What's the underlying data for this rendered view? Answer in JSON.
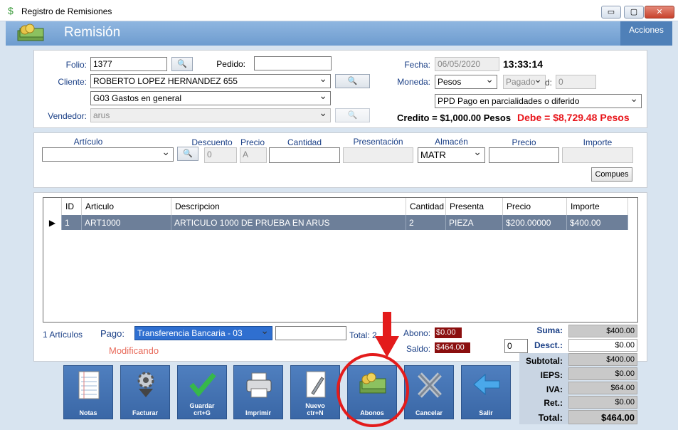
{
  "window": {
    "title": "Registro de Remisiones",
    "min": "▭",
    "max": "▢",
    "close": "✕"
  },
  "header": {
    "title": "Remisión",
    "acciones": "Acciones"
  },
  "form": {
    "folio_label": "Folio:",
    "folio": "1377",
    "pedido_label": "Pedido:",
    "pedido": "",
    "cliente_label": "Cliente:",
    "cliente": "ROBERTO LOPEZ HERNANDEZ 655",
    "uso": "G03 Gastos en general",
    "vendedor_label": "Vendedor:",
    "vendedor": "arus",
    "fecha_label": "Fecha:",
    "fecha": "06/05/2020",
    "hora": "13:33:14",
    "moneda_label": "Moneda:",
    "moneda": "Pesos",
    "pagado": "Pagado",
    "pagado_suffix": "d:",
    "dias": "0",
    "metodo": "PPD Pago en parcialidades o diferido",
    "credito": "Credito = $1,000.00 Pesos",
    "debe": "Debe = $8,729.48 Pesos"
  },
  "articulo": {
    "articulo_label": "Artículo",
    "descuento_label": "Descuento",
    "precio_label": "Precio",
    "cantidad_label": "Cantidad",
    "presentacion_label": "Presentación",
    "almacen_label": "Almacén",
    "precio2_label": "Precio",
    "importe_label": "Importe",
    "descuento": "0",
    "precio": "A",
    "almacen": "MATR",
    "compues": "Compues"
  },
  "grid": {
    "columns": [
      "ID",
      "Articulo",
      "Descripcion",
      "Cantidad",
      "Presenta",
      "Precio",
      "Importe"
    ],
    "rows": [
      {
        "marker": "▶",
        "id": "1",
        "articulo": "ART1000",
        "descripcion": "ARTICULO 1000 DE PRUEBA EN ARUS",
        "cantidad": "2",
        "presenta": "PIEZA",
        "precio": "$200.00000",
        "importe": "$400.00"
      }
    ]
  },
  "footer": {
    "articulos": "1 Artículos",
    "pago_label": "Pago:",
    "pago": "Transferencia Bancaria - 03",
    "total_label": "Total: 2",
    "abono_label": "Abono:",
    "abono": "$0.00",
    "saldo_label": "Saldo:",
    "saldo": "$464.00",
    "status": "Modificando",
    "desc_input": "0"
  },
  "totals": {
    "suma_label": "Suma:",
    "suma": "$400.00",
    "desc_label": "Desct.:",
    "desc": "$0.00",
    "subtotal_label": "Subtotal:",
    "subtotal": "$400.00",
    "ieps_label": "IEPS:",
    "ieps": "$0.00",
    "iva_label": "IVA:",
    "iva": "$64.00",
    "ret_label": "Ret.:",
    "ret": "$0.00",
    "total_label": "Total:",
    "total": "$464.00"
  },
  "toolbar": {
    "notas": "Notas",
    "facturar": "Facturar",
    "guardar": "Guardar",
    "guardar_sc": "crt+G",
    "imprimir": "Imprimir",
    "nuevo": "Nuevo",
    "nuevo_sc": "ctr+N",
    "abonos": "Abonos",
    "cancelar": "Cancelar",
    "salir": "Salir"
  },
  "colors": {
    "accent": "#4f80b8",
    "debe": "#e8141a",
    "annotation": "#e31b1b",
    "badge": "#8b0f0f"
  }
}
